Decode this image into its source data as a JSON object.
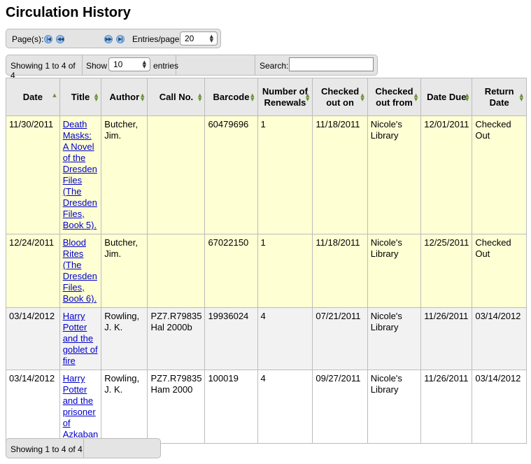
{
  "page": {
    "title": "Circulation History"
  },
  "pager": {
    "pages_label": "Page(s):",
    "entries_label": "Entries/page:",
    "entries_value": "20",
    "first_glyph": "|◀",
    "prev_glyph": "◀◀",
    "next_glyph": "▶▶",
    "last_glyph": "▶|"
  },
  "info": {
    "showing": "Showing 1 to 4 of 4",
    "show_label": "Show",
    "show_value": "10",
    "entries_label": "entries",
    "search_label": "Search:",
    "search_value": ""
  },
  "table": {
    "headers": {
      "date": "Date",
      "title": "Title",
      "author": "Author",
      "callno": "Call No.",
      "barcode": "Barcode",
      "renewals": "Number of Renewals",
      "checked_out_on": "Checked out on",
      "checked_out_from": "Checked out from",
      "date_due": "Date Due",
      "return_date": "Return Date"
    },
    "rows": [
      {
        "date": "11/30/2011",
        "title": "Death Masks: A Novel of the Dresden Files (The Dresden Files, Book 5).",
        "author": "Butcher, Jim.",
        "callno": "",
        "barcode": "60479696",
        "renewals": "1",
        "checked_out_on": "11/18/2011",
        "checked_out_from": "Nicole's Library",
        "date_due": "12/01/2011",
        "return_date": "Checked Out"
      },
      {
        "date": "12/24/2011",
        "title": "Blood Rites (The Dresden Files, Book 6).",
        "author": "Butcher, Jim.",
        "callno": "",
        "barcode": "67022150",
        "renewals": "1",
        "checked_out_on": "11/18/2011",
        "checked_out_from": "Nicole's Library",
        "date_due": "12/25/2011",
        "return_date": "Checked Out"
      },
      {
        "date": "03/14/2012",
        "title": "Harry Potter and the goblet of fire",
        "author": "Rowling, J. K.",
        "callno": "PZ7.R79835 Hal 2000b",
        "barcode": "19936024",
        "renewals": "4",
        "checked_out_on": "07/21/2011",
        "checked_out_from": "Nicole's Library",
        "date_due": "11/26/2011",
        "return_date": "03/14/2012"
      },
      {
        "date": "03/14/2012",
        "title": "Harry Potter and the prisoner of Azkaban",
        "author": "Rowling, J. K.",
        "callno": "PZ7.R79835 Ham 2000",
        "barcode": "100019",
        "renewals": "4",
        "checked_out_on": "09/27/2011",
        "checked_out_from": "Nicole's Library",
        "date_due": "11/26/2011",
        "return_date": "03/14/2012"
      }
    ]
  },
  "footer": {
    "showing": "Showing 1 to 4 of 4"
  },
  "colors": {
    "overdue_row": "#ffffd4",
    "link": "#0000cc",
    "header_bg": "#e8e8e8"
  }
}
